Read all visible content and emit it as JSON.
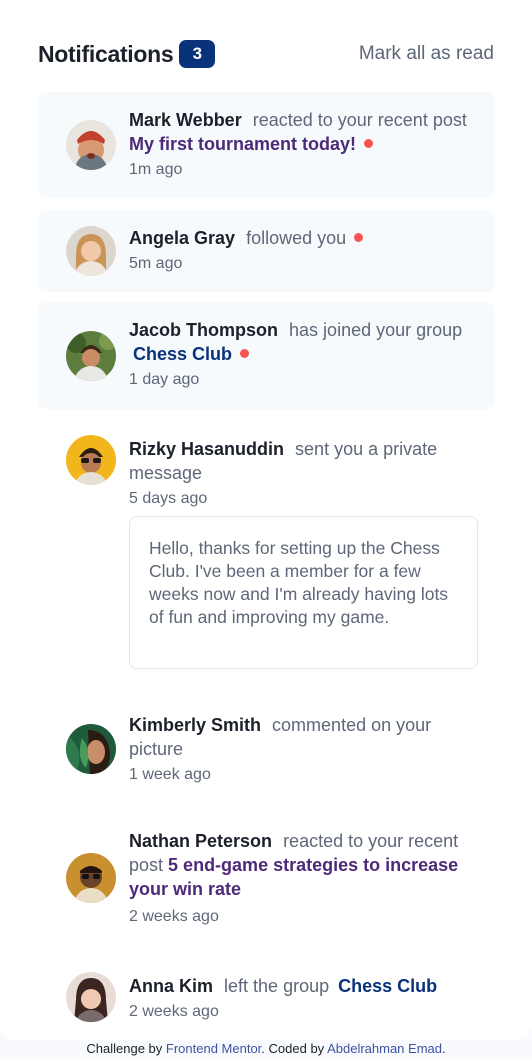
{
  "header": {
    "title": "Notifications",
    "unread_count": "3",
    "mark_all_label": "Mark all as read"
  },
  "notifications": [
    {
      "name": "Mark Webber",
      "action": "reacted to your recent post",
      "target": "My first tournament today!",
      "time": "1m ago",
      "unread": true
    },
    {
      "name": "Angela Gray",
      "action": "followed you",
      "time": "5m ago",
      "unread": true
    },
    {
      "name": "Jacob Thompson",
      "action": "has joined your group",
      "target": "Chess Club",
      "time": "1 day ago",
      "unread": true
    },
    {
      "name": "Rizky Hasanuddin",
      "action": "sent you a private message",
      "time": "5 days ago",
      "message": "Hello, thanks for setting up the Chess Club. I've been a member for a few weeks now and I'm already having lots of fun and improving my game.",
      "unread": false
    },
    {
      "name": "Kimberly Smith",
      "action": "commented on your picture",
      "time": "1 week ago",
      "unread": false
    },
    {
      "name": "Nathan Peterson",
      "action": "reacted to your recent post",
      "target": "5 end-game strategies to increase your win rate",
      "time": "2 weeks ago",
      "unread": false
    },
    {
      "name": "Anna Kim",
      "action": "left the group",
      "target": "Chess Club",
      "time": "2 weeks ago",
      "unread": false
    }
  ],
  "footer": {
    "prefix": "Challenge by",
    "link1": "Frontend Mentor",
    "middle": ". Coded by",
    "link2": "Abdelrahman Emad",
    "suffix": "."
  },
  "colors": {
    "accent_blue": "#0a327b",
    "unread_dot": "#f65552",
    "post_purple": "#4d2a78",
    "unread_bg": "#f7fafd"
  }
}
